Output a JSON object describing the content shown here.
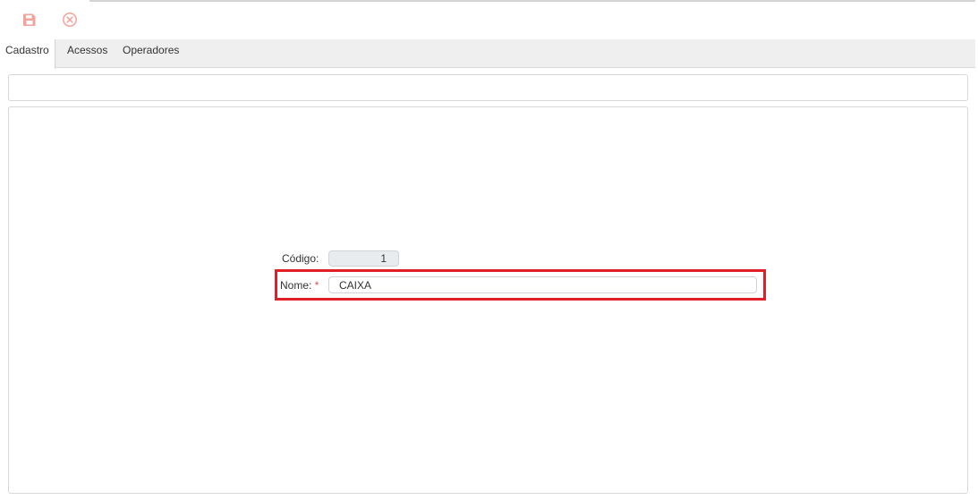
{
  "toolbar": {
    "save_icon": "save-icon",
    "cancel_icon": "close-circle-icon",
    "icon_color": "#f4a29a"
  },
  "tabs": [
    {
      "label": "Cadastro",
      "active": true
    },
    {
      "label": "Acessos",
      "active": false
    },
    {
      "label": "Operadores",
      "active": false
    }
  ],
  "form": {
    "codigo_label": "Código:",
    "codigo_value": "1",
    "nome_label": "Nome:",
    "nome_required": "*",
    "nome_value": "CAIXA"
  },
  "colors": {
    "highlight": "#e01f26",
    "required": "#d9534f",
    "tabbar_bg": "#efefef"
  }
}
